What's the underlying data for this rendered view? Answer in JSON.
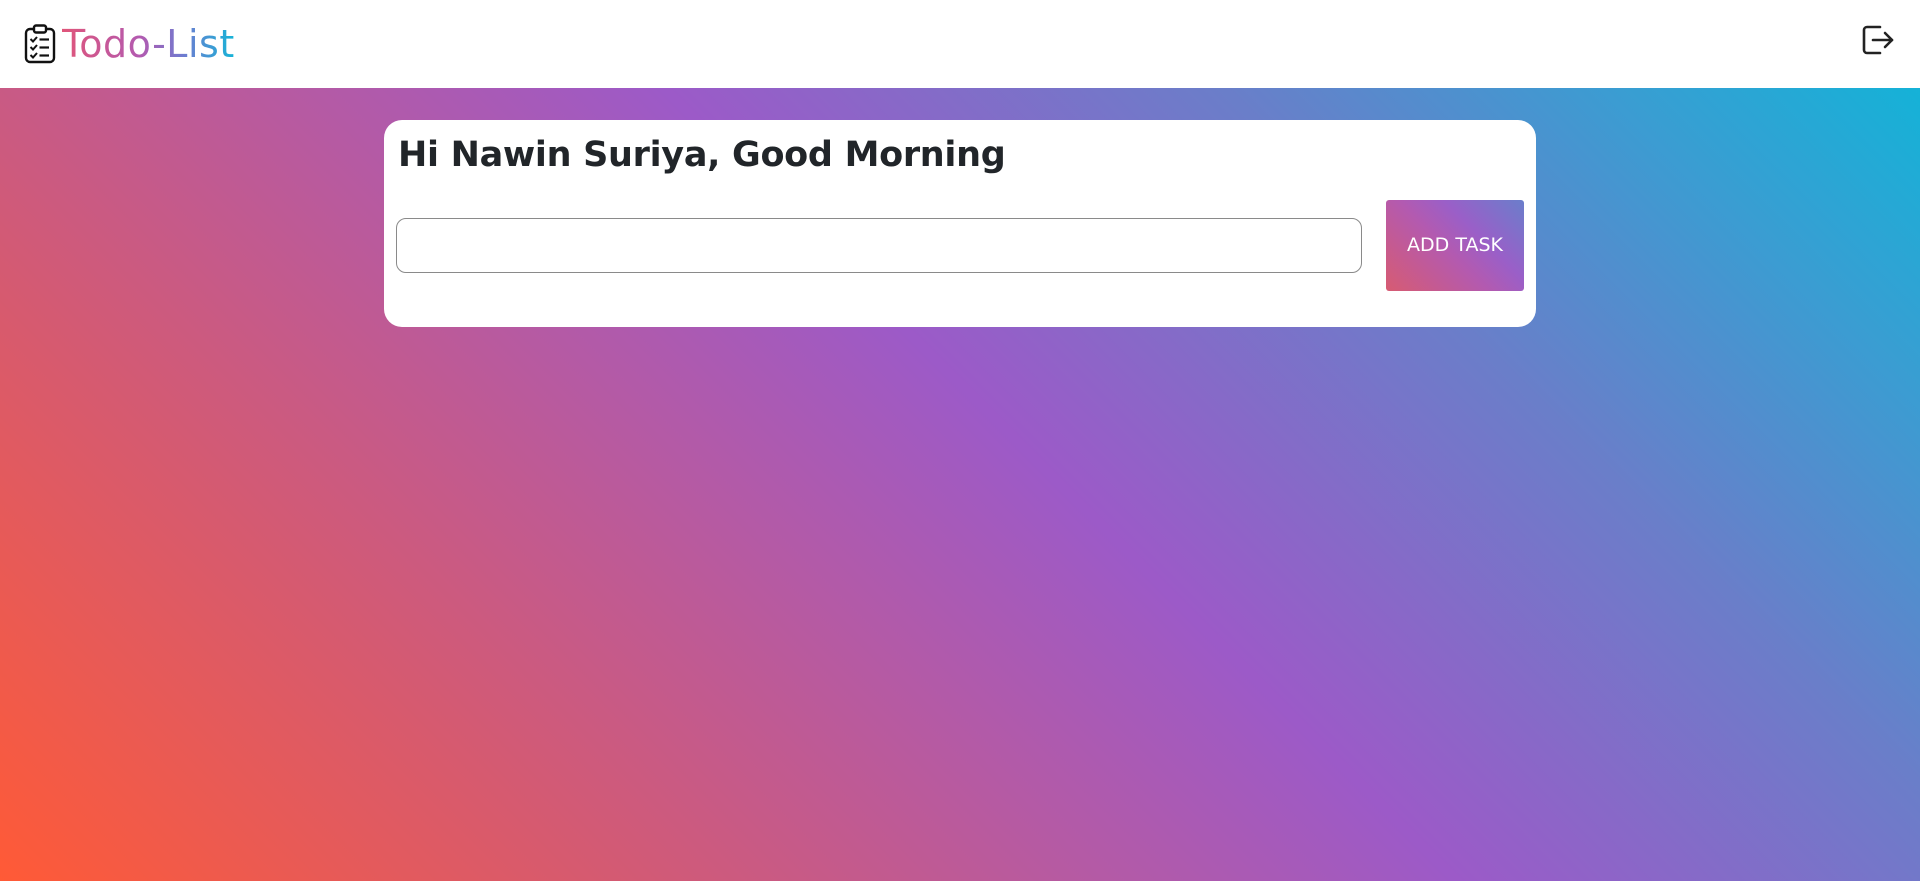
{
  "navbar": {
    "brand_text": "Todo-List",
    "brand_icon": "clipboard-checklist-icon",
    "logout_icon": "logout-icon"
  },
  "main": {
    "greeting": "Hi Nawin Suriya, Good Morning",
    "task_input": {
      "value": "",
      "placeholder": ""
    },
    "add_button_label": "ADD TASK"
  },
  "colors": {
    "background_gradient": [
      "#ff5a36",
      "#b35aa7",
      "#9c5ac8",
      "#0ab8d9"
    ],
    "brand_gradient": [
      "#e0557a",
      "#b35ab0",
      "#15b5d8"
    ],
    "text": "#212529"
  }
}
